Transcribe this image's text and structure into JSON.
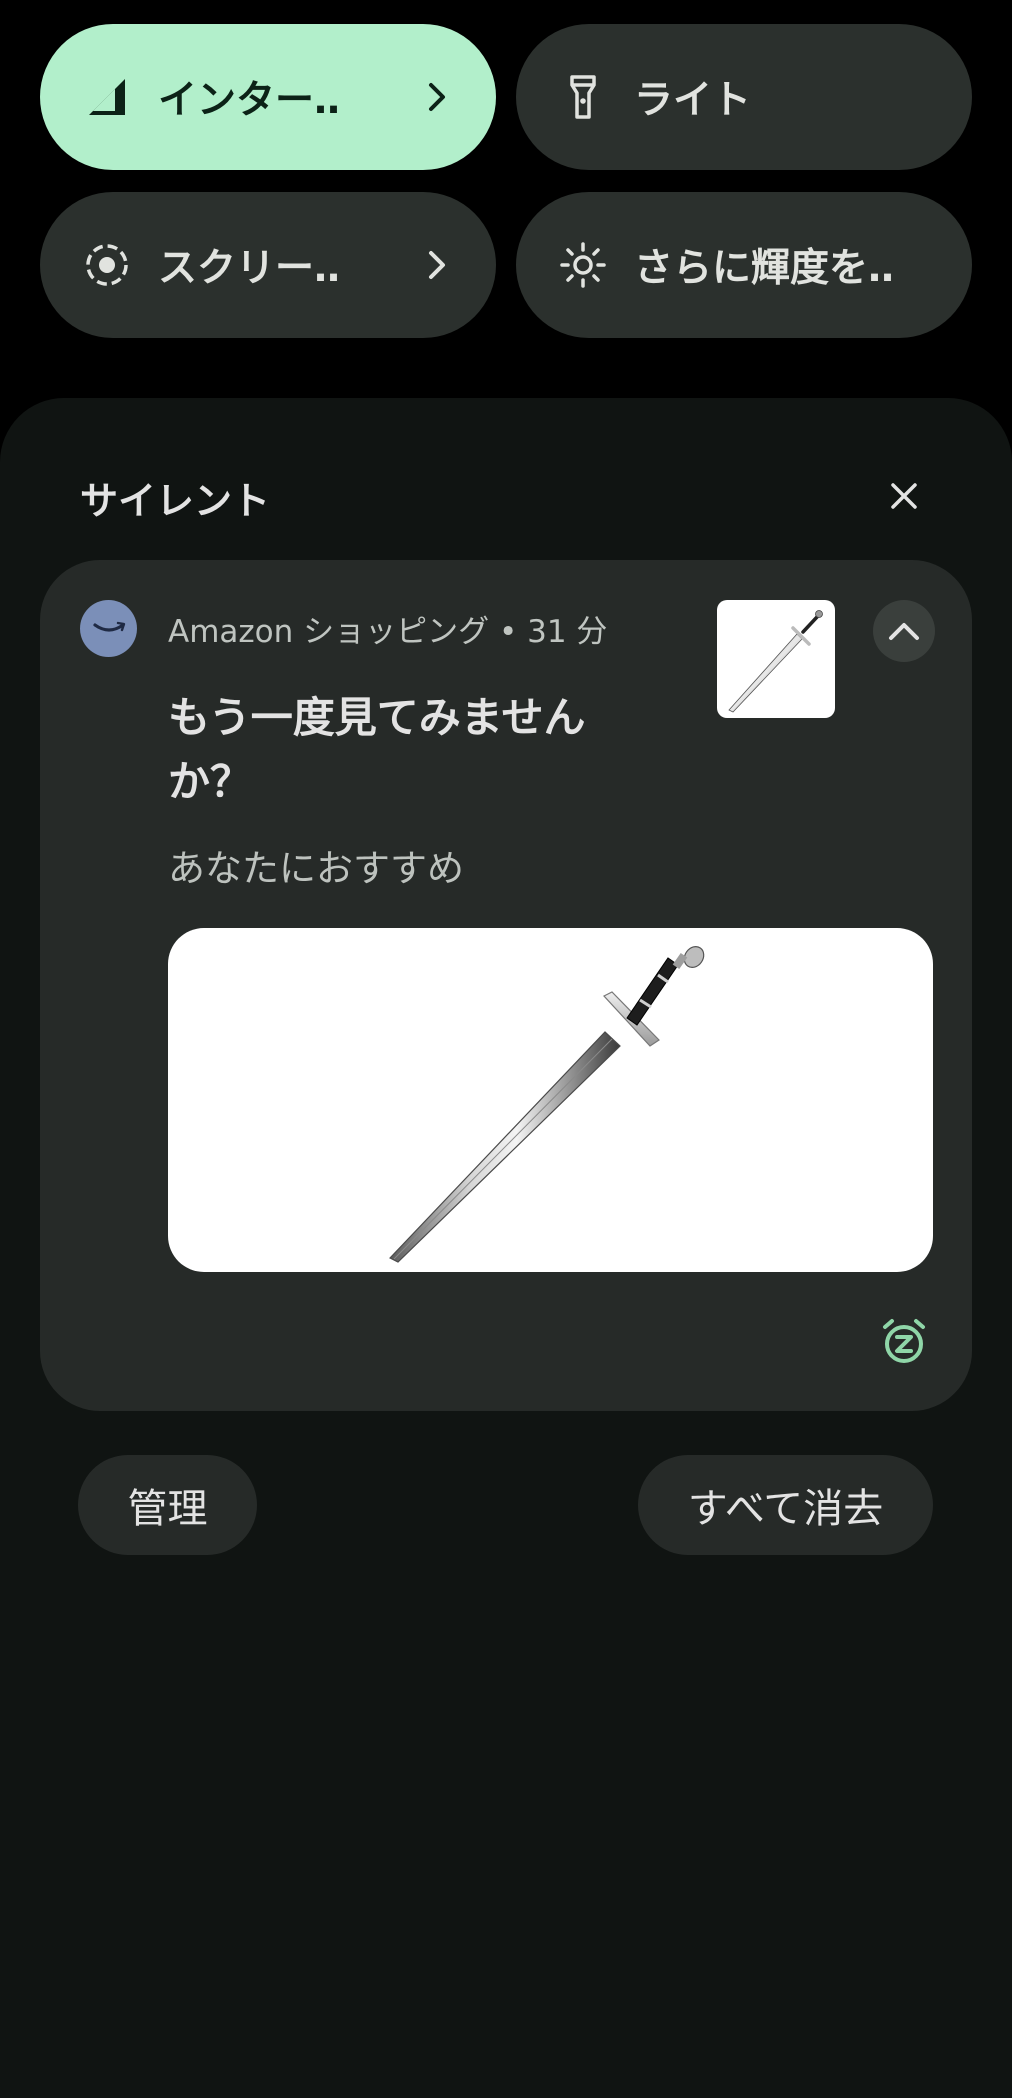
{
  "quick_settings": {
    "tiles": [
      {
        "label": "インター‥",
        "icon": "signal-icon",
        "state": "active",
        "has_chevron": true
      },
      {
        "label": "ライト",
        "icon": "flashlight-icon",
        "state": "inactive",
        "has_chevron": false
      },
      {
        "label": "スクリー‥",
        "icon": "screen-record-icon",
        "state": "inactive",
        "has_chevron": true
      },
      {
        "label": "さらに輝度を‥",
        "icon": "brightness-icon",
        "state": "inactive",
        "has_chevron": false
      }
    ]
  },
  "shade": {
    "section_title": "サイレント",
    "dismiss_icon": "close-icon"
  },
  "notification": {
    "app_name": "Amazon ショッピング",
    "separator": "•",
    "time": "31 分",
    "header": "Amazon ショッピング • 31 分",
    "title": "もう一度見てみませんか？",
    "subtitle": "あなたにおすすめ",
    "thumbnail": "sword-image",
    "image": "sword-image",
    "expand_icon": "chevron-up-icon",
    "snooze_icon": "snooze-alarm-icon"
  },
  "footer": {
    "manage_label": "管理",
    "clear_all_label": "すべて消去"
  },
  "colors": {
    "background": "#000000",
    "shade": "#101412",
    "card": "#262a28",
    "tile_active": "#b2efcb",
    "tile_inactive": "#2b302d",
    "accent_green": "#8fd6a8",
    "app_icon": "#7b8fb8"
  }
}
